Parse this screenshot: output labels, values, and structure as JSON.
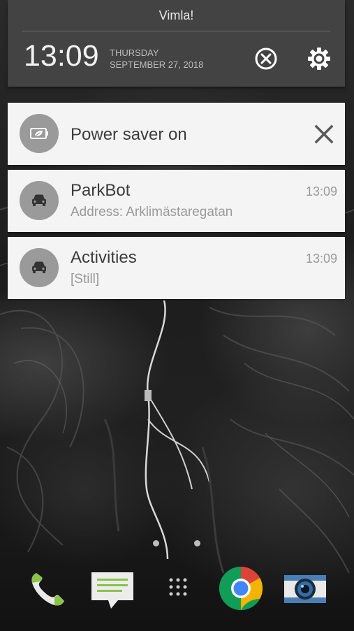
{
  "status": {
    "carrier": "Vimla!",
    "time": "13:09",
    "day": "THURSDAY",
    "date": "SEPTEMBER 27, 2018"
  },
  "header_icons": [
    "clear-all-icon",
    "settings-icon"
  ],
  "notifications": [
    {
      "app": "power-saver",
      "title": "Power saver on",
      "icon": "battery-leaf-icon"
    },
    {
      "app": "parkbot",
      "title": "ParkBot",
      "subtitle": "Address:  Arklimästaregatan",
      "time": "13:09",
      "icon": "car-icon"
    },
    {
      "app": "activities",
      "title": "Activities",
      "subtitle": "[Still]",
      "time": "13:09",
      "icon": "car-icon"
    }
  ],
  "dock": [
    "phone-icon",
    "messages-icon",
    "app-drawer-icon",
    "chrome-icon",
    "camera-icon"
  ],
  "colors": {
    "shade": "#434343",
    "card": "#f4f4f4",
    "avatar": "#9a9a9a",
    "title_text": "#3c3c3c",
    "secondary_text": "#9a9a9a"
  }
}
